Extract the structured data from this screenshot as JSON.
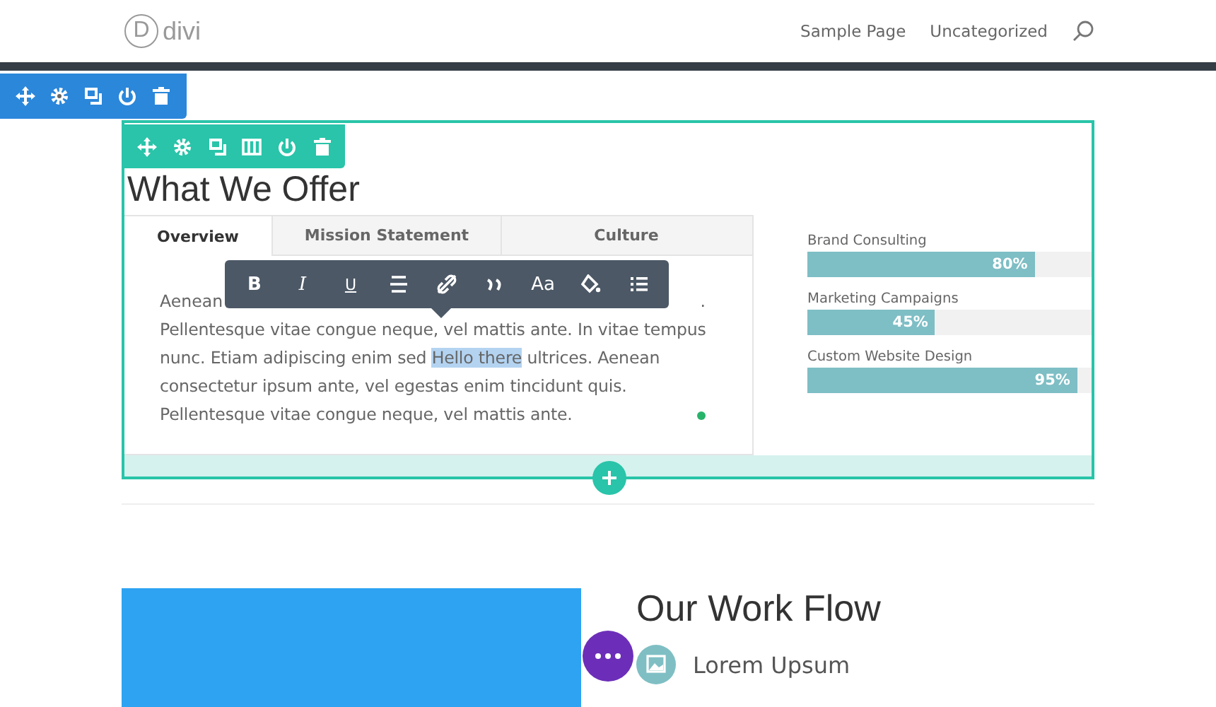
{
  "header": {
    "logo_letter": "D",
    "logo_text": "divi",
    "nav": [
      "Sample Page",
      "Uncategorized"
    ]
  },
  "section_tools": [
    {
      "kind": "move"
    },
    {
      "kind": "settings"
    },
    {
      "kind": "duplicate"
    },
    {
      "kind": "power"
    },
    {
      "kind": "trash"
    }
  ],
  "row_tools": [
    {
      "kind": "move"
    },
    {
      "kind": "settings"
    },
    {
      "kind": "duplicate"
    },
    {
      "kind": "columns"
    },
    {
      "kind": "power"
    },
    {
      "kind": "trash"
    }
  ],
  "module": {
    "heading": "What We Offer",
    "tabs": [
      {
        "label": "Overview",
        "selected": true
      },
      {
        "label": "Mission Statement",
        "selected": false
      },
      {
        "label": "Culture",
        "selected": false
      }
    ],
    "paragraph": {
      "lead": "Aenean",
      "lead_end": ".",
      "before": "Pellentesque vitae congue neque, vel mattis ante. In vitae tempus nunc. Etiam adipiscing enim sed ",
      "selected": "Hello there",
      "after": " ultrices. Aenean consectetur ipsum ante, vel egestas enim tincidunt quis. Pellentesque vitae congue neque, vel mattis ante."
    },
    "format_toolbar": [
      {
        "kind": "bold",
        "label": "B"
      },
      {
        "kind": "italic",
        "label": "I"
      },
      {
        "kind": "underline",
        "label": "U"
      },
      {
        "kind": "align"
      },
      {
        "kind": "link"
      },
      {
        "kind": "quote"
      },
      {
        "kind": "text",
        "label": "Aa"
      },
      {
        "kind": "color"
      },
      {
        "kind": "list"
      }
    ]
  },
  "bars": [
    {
      "label": "Brand Consulting",
      "level": 0.8,
      "reading": "80%"
    },
    {
      "label": "Marketing Campaigns",
      "level": 0.45,
      "reading": "45%"
    },
    {
      "label": "Custom Website Design",
      "level": 0.95,
      "reading": "95%"
    }
  ],
  "work_flow": {
    "heading": "Our Work Flow",
    "items": [
      {
        "label": "Lorem Upsum"
      }
    ]
  }
}
